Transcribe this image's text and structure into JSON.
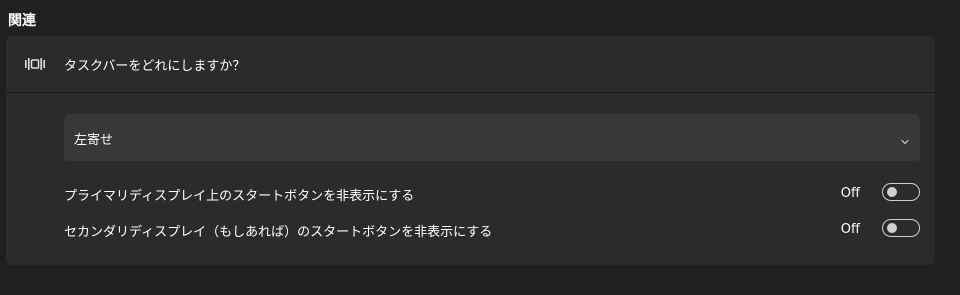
{
  "section": {
    "title": "関連"
  },
  "card": {
    "header_icon": "taskbar-alignment-icon",
    "header_label": "タスクバーをどれにしますか？",
    "dropdown": {
      "selected": "左寄せ",
      "chevron_icon": "chevron-down-icon"
    },
    "toggles": [
      {
        "label": "プライマリディスプレイ上のスタートボタンを非表示にする",
        "state": "Off"
      },
      {
        "label": "セカンダリディスプレイ（もしあれば）のスタートボタンを非表示にする",
        "state": "Off"
      }
    ]
  },
  "colors": {
    "background": "#202020",
    "card": "#2b2b2b",
    "dropdown": "#383838",
    "text": "#ffffff"
  }
}
